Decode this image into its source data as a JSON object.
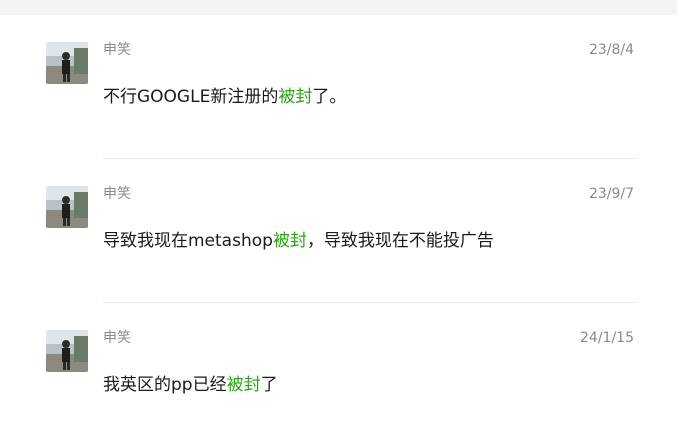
{
  "messages": [
    {
      "author": "申笑",
      "date": "23/8/4",
      "text_before": "不行GOOGLE新注册的",
      "highlight": "被封",
      "text_after": "了。"
    },
    {
      "author": "申笑",
      "date": "23/9/7",
      "text_before": "导致我现在metashop",
      "highlight": "被封",
      "text_after": "，导致我现在不能投广告"
    },
    {
      "author": "申笑",
      "date": "24/1/15",
      "text_before": "我英区的pp已经",
      "highlight": "被封",
      "text_after": "了"
    }
  ],
  "colors": {
    "highlight": "#2aa515",
    "meta_text": "#8a8a8a",
    "body_text": "#1a1a1a"
  }
}
